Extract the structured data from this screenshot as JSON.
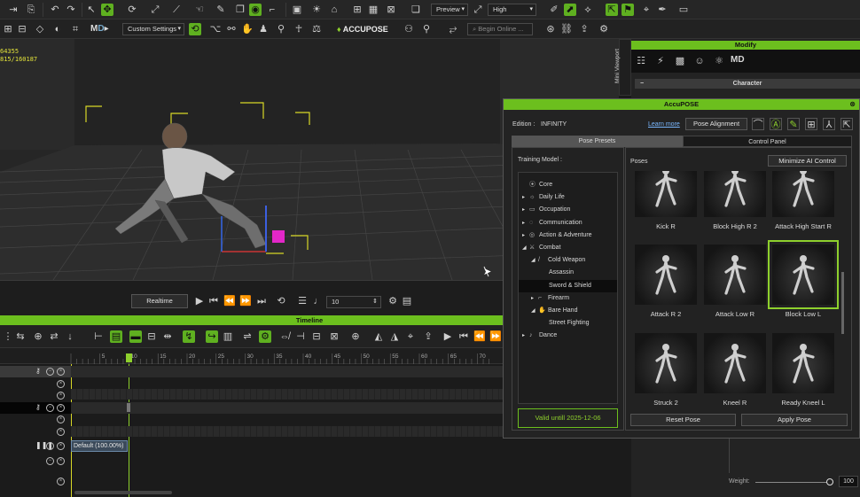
{
  "toolbar": {
    "preview_label": "Preview",
    "quality_label": "High",
    "custom_settings_label": "Custom Settings",
    "accupose_brand": "ACCUPOSE",
    "search_placeholder": "Begin Online ..."
  },
  "viewport": {
    "readout_line1": "64355",
    "readout_line2": "815/160187"
  },
  "playback": {
    "mode_label": "Realtime",
    "frame_value": "10"
  },
  "timeline": {
    "title": "Timeline",
    "ruler_ticks": [
      "5",
      "10",
      "15",
      "20",
      "25",
      "30",
      "35",
      "40",
      "45",
      "50",
      "55",
      "60",
      "65",
      "70"
    ],
    "clip_label": "Default (100.00%)"
  },
  "modify_panel": {
    "title": "Modify",
    "mini_viewport_label": "Mini Viewport",
    "character_section": "Character",
    "weight_label": "Weight:",
    "weight_value": "100"
  },
  "accupose": {
    "title": "AccuPOSE",
    "edition_label": "Edition :",
    "edition_value": "INFINITY",
    "learn_more": "Learn more",
    "pose_alignment": "Pose Alignment",
    "tab_presets": "Pose Presets",
    "tab_control": "Control Panel",
    "training_model_label": "Training Model :",
    "poses_label": "Poses",
    "minimize_label": "Minimize AI Control",
    "valid_label": "Valid untill 2025-12-06",
    "reset_label": "Reset Pose",
    "apply_label": "Apply Pose",
    "tree": [
      {
        "label": "Core",
        "indent": 0,
        "arrow": "",
        "icon": "⦿"
      },
      {
        "label": "Daily Life",
        "indent": 0,
        "arrow": "▸",
        "icon": "☼"
      },
      {
        "label": "Occupation",
        "indent": 0,
        "arrow": "▸",
        "icon": "▭"
      },
      {
        "label": "Communication",
        "indent": 0,
        "arrow": "▸",
        "icon": "◌"
      },
      {
        "label": "Action & Adventure",
        "indent": 0,
        "arrow": "▸",
        "icon": "◎"
      },
      {
        "label": "Combat",
        "indent": 0,
        "arrow": "◢",
        "icon": "⚔"
      },
      {
        "label": "Cold Weapon",
        "indent": 1,
        "arrow": "◢",
        "icon": "/"
      },
      {
        "label": "Assassin",
        "indent": 2,
        "arrow": "",
        "icon": ""
      },
      {
        "label": "Sword & Shield",
        "indent": 2,
        "arrow": "",
        "icon": ""
      },
      {
        "label": "Firearm",
        "indent": 1,
        "arrow": "▸",
        "icon": "⌐"
      },
      {
        "label": "Bare Hand",
        "indent": 1,
        "arrow": "◢",
        "icon": "✋"
      },
      {
        "label": "Street Fighting",
        "indent": 2,
        "arrow": "",
        "icon": ""
      },
      {
        "label": "Dance",
        "indent": 0,
        "arrow": "▸",
        "icon": "♪"
      }
    ],
    "poses": [
      {
        "name": "Kick R"
      },
      {
        "name": "Block High R 2"
      },
      {
        "name": "Attack High Start R"
      },
      {
        "name": "Attack R 2"
      },
      {
        "name": "Attack Low R"
      },
      {
        "name": "Block Low L"
      },
      {
        "name": "Struck 2"
      },
      {
        "name": "Kneel R"
      },
      {
        "name": "Ready Kneel L"
      }
    ]
  },
  "colors": {
    "accent": "#6cbf1e",
    "selection": "#8ed02d",
    "panel_bg": "#232323"
  }
}
